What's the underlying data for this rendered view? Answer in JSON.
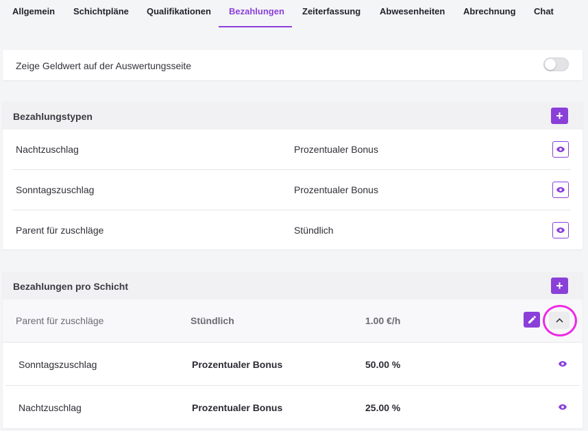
{
  "tabs": [
    {
      "label": "Allgemein"
    },
    {
      "label": "Schichtpläne"
    },
    {
      "label": "Qualifikationen"
    },
    {
      "label": "Bezahlungen"
    },
    {
      "label": "Zeiterfassung"
    },
    {
      "label": "Abwesenheiten"
    },
    {
      "label": "Abrechnung"
    },
    {
      "label": "Chat"
    }
  ],
  "active_tab": "Bezahlungen",
  "settings": {
    "show_money_label": "Zeige Geldwert auf der Auswertungsseite",
    "show_money_enabled": false
  },
  "payment_types": {
    "title": "Bezahlungstypen",
    "add_icon": "plus-icon",
    "rows": [
      {
        "name": "Nachtzuschlag",
        "kind": "Prozentualer Bonus",
        "icon": "eye-icon"
      },
      {
        "name": "Sonntagszuschlag",
        "kind": "Prozentualer Bonus",
        "icon": "eye-icon"
      },
      {
        "name": "Parent für zuschläge",
        "kind": "Stündlich",
        "icon": "eye-icon"
      }
    ]
  },
  "shift_payments": {
    "title": "Bezahlungen pro Schicht",
    "add_icon": "plus-icon",
    "parent": {
      "name": "Parent für zuschläge",
      "kind": "Stündlich",
      "amount": "1.00 €/h",
      "edit_icon": "pencil-icon",
      "collapse_icon": "chevron-up-icon"
    },
    "children": [
      {
        "name": "Sonntagszuschlag",
        "kind": "Prozentualer Bonus",
        "amount": "50.00 %",
        "icon": "eye-icon"
      },
      {
        "name": "Nachtzuschlag",
        "kind": "Prozentualer Bonus",
        "amount": "25.00 %",
        "icon": "eye-icon"
      }
    ]
  },
  "colors": {
    "accent": "#8a3fd9",
    "highlight": "#f028e6"
  }
}
